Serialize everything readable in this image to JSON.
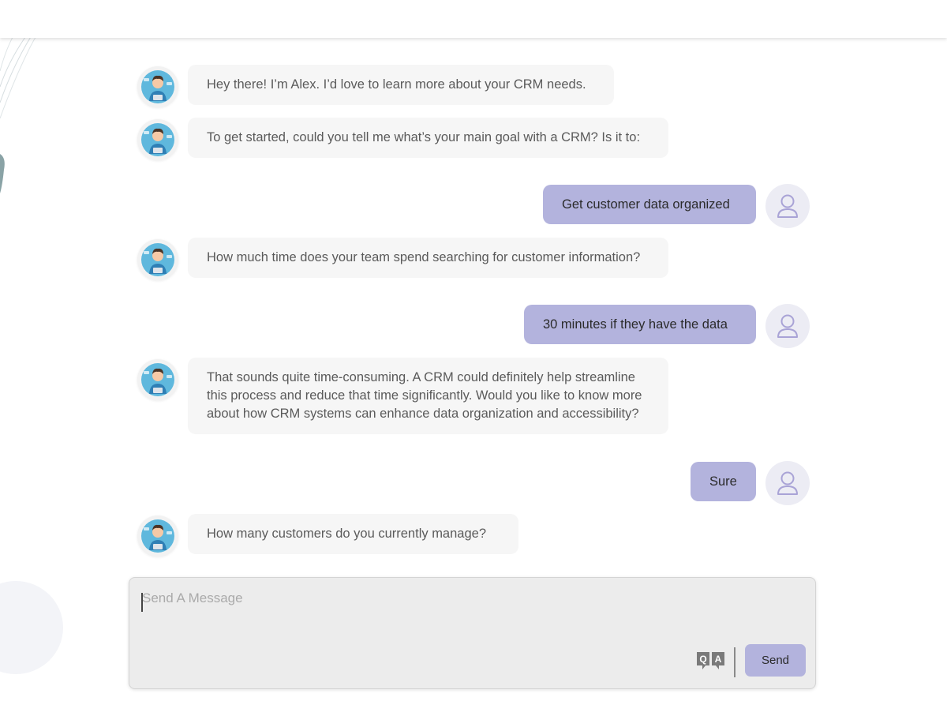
{
  "messages": [
    {
      "sender": "bot",
      "text": "Hey there! I’m Alex. I’d love to learn more about your CRM needs."
    },
    {
      "sender": "bot",
      "text": "To get started, could you tell me what’s your main goal with a CRM? Is it to:"
    },
    {
      "sender": "user",
      "text": "Get customer data organized"
    },
    {
      "sender": "bot",
      "text": "How much time does your team spend searching for customer information?"
    },
    {
      "sender": "user",
      "text": "30 minutes if they have the data"
    },
    {
      "sender": "bot",
      "text": "That sounds quite time-consuming. A CRM could definitely help streamline this process and reduce that time significantly. Would you like to know more about how CRM systems can enhance data organization and accessibility?"
    },
    {
      "sender": "user",
      "text": "Sure"
    },
    {
      "sender": "bot",
      "text": "How many customers do you currently manage?"
    }
  ],
  "composer": {
    "placeholder": "Send A Message",
    "value": "",
    "qa_icon": "qa-icon",
    "send_label": "Send"
  },
  "colors": {
    "user_bubble": "#b3b3dd",
    "bot_bubble": "#f6f6f6",
    "send_button": "#b3b3dd",
    "composer_bg": "#ececec"
  },
  "icons": {
    "bot_avatar": "bot-avatar-icon",
    "user_avatar": "user-icon"
  }
}
